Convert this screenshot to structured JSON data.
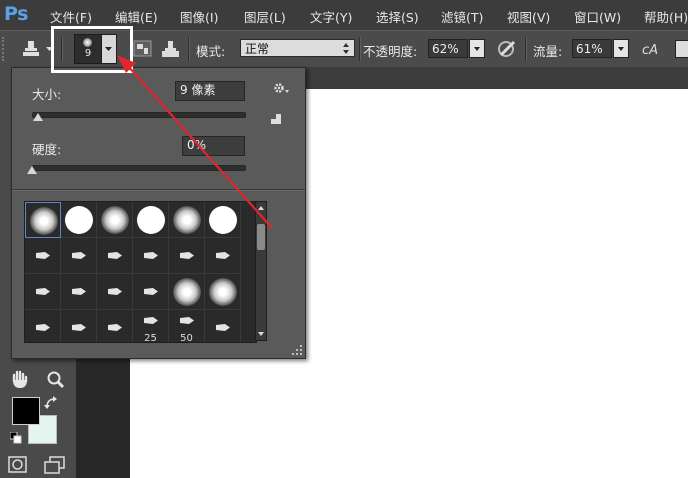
{
  "app": {
    "logo": "Ps"
  },
  "menu": [
    {
      "label": "文件(F)"
    },
    {
      "label": "编辑(E)"
    },
    {
      "label": "图像(I)"
    },
    {
      "label": "图层(L)"
    },
    {
      "label": "文字(Y)"
    },
    {
      "label": "选择(S)"
    },
    {
      "label": "滤镜(T)"
    },
    {
      "label": "视图(V)"
    },
    {
      "label": "窗口(W)"
    },
    {
      "label": "帮助(H)"
    }
  ],
  "options_bar": {
    "brush_size_preview": "9",
    "mode_label": "模式:",
    "mode_value": "正常",
    "opacity_label": "不透明度:",
    "opacity_value": "62%",
    "flow_label": "流量:",
    "flow_value": "61%"
  },
  "brush_popup": {
    "size_label": "大小:",
    "size_value": "9 像素",
    "size_slider_fraction": 0.03,
    "hardness_label": "硬度:",
    "hardness_value": "0%",
    "hardness_slider_fraction": 0.0,
    "presets": [
      {
        "kind": "soft",
        "selected": true
      },
      {
        "kind": "hard"
      },
      {
        "kind": "soft"
      },
      {
        "kind": "hard"
      },
      {
        "kind": "soft"
      },
      {
        "kind": "hard"
      },
      {
        "kind": "tip"
      },
      {
        "kind": "tip"
      },
      {
        "kind": "tip"
      },
      {
        "kind": "tip"
      },
      {
        "kind": "tip"
      },
      {
        "kind": "tip"
      },
      {
        "kind": "tip"
      },
      {
        "kind": "tip"
      },
      {
        "kind": "tip"
      },
      {
        "kind": "tip"
      },
      {
        "kind": "soft"
      },
      {
        "kind": "soft"
      },
      {
        "kind": "tip"
      },
      {
        "kind": "tip"
      },
      {
        "kind": "tip"
      },
      {
        "kind": "tip",
        "label": "25"
      },
      {
        "kind": "tip",
        "label": "50"
      },
      {
        "kind": "tip"
      }
    ]
  },
  "colors": {
    "foreground": "#000000",
    "background": "#e4f5ef",
    "highlight_box": "#ffffff",
    "annotation_arrow": "#e0252b",
    "ps_logo": "#5aa2e6"
  }
}
